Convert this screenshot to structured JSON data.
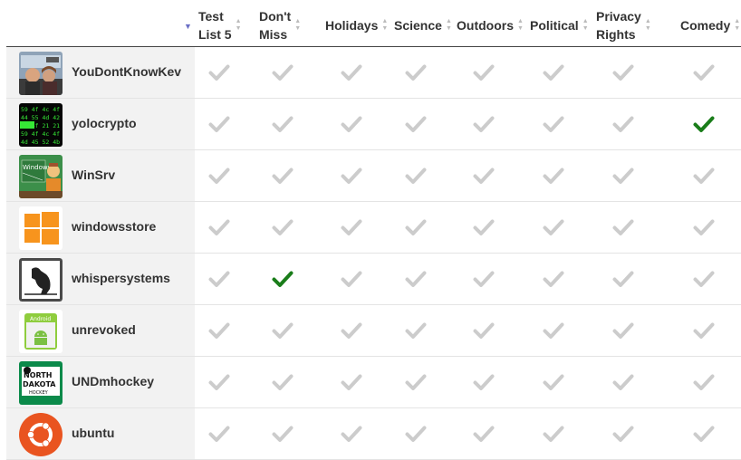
{
  "columns": [
    {
      "label_line1": "Test",
      "label_line2": "List 5"
    },
    {
      "label_line1": "Don't",
      "label_line2": "Miss"
    },
    {
      "label_line1": "Holidays",
      "label_line2": ""
    },
    {
      "label_line1": "Science",
      "label_line2": ""
    },
    {
      "label_line1": "Outdoors",
      "label_line2": ""
    },
    {
      "label_line1": "Political",
      "label_line2": ""
    },
    {
      "label_line1": "Privacy",
      "label_line2": "Rights"
    },
    {
      "label_line1": "Comedy",
      "label_line2": ""
    }
  ],
  "sort_indicator": "▼",
  "colors": {
    "checked": "#1a7d1a",
    "unchecked": "#cccccc",
    "sort_active": "#6b6fc5"
  },
  "rows": [
    {
      "name": "YouDontKnowKev",
      "avatar": "photo-avatar",
      "checked": [
        false,
        false,
        false,
        false,
        false,
        false,
        false,
        false
      ]
    },
    {
      "name": "yolocrypto",
      "avatar": "hex-code-avatar",
      "checked": [
        false,
        false,
        false,
        false,
        false,
        false,
        false,
        true
      ]
    },
    {
      "name": "WinSrv",
      "avatar": "windows-server-avatar",
      "checked": [
        false,
        false,
        false,
        false,
        false,
        false,
        false,
        false
      ]
    },
    {
      "name": "windowsstore",
      "avatar": "windows-logo-avatar",
      "checked": [
        false,
        false,
        false,
        false,
        false,
        false,
        false,
        false
      ]
    },
    {
      "name": "whispersystems",
      "avatar": "raven-avatar",
      "checked": [
        false,
        true,
        false,
        false,
        false,
        false,
        false,
        false
      ]
    },
    {
      "name": "unrevoked",
      "avatar": "android-avatar",
      "checked": [
        false,
        false,
        false,
        false,
        false,
        false,
        false,
        false
      ]
    },
    {
      "name": "UNDmhockey",
      "avatar": "north-dakota-hockey-avatar",
      "checked": [
        false,
        false,
        false,
        false,
        false,
        false,
        false,
        false
      ]
    },
    {
      "name": "ubuntu",
      "avatar": "ubuntu-logo-avatar",
      "checked": [
        false,
        false,
        false,
        false,
        false,
        false,
        false,
        false
      ]
    }
  ],
  "avatar_text": {
    "yolocrypto": [
      "59 4f 4c 4f",
      "44 55 4d 42",
      "59 4f 21 21",
      "59 4f 4c 4f",
      "4d 45 52 4b"
    ],
    "windows_server": "Windows",
    "android": "Android",
    "nd_hockey": [
      "NORTH",
      "DAKOTA",
      "HOCKEY"
    ]
  }
}
